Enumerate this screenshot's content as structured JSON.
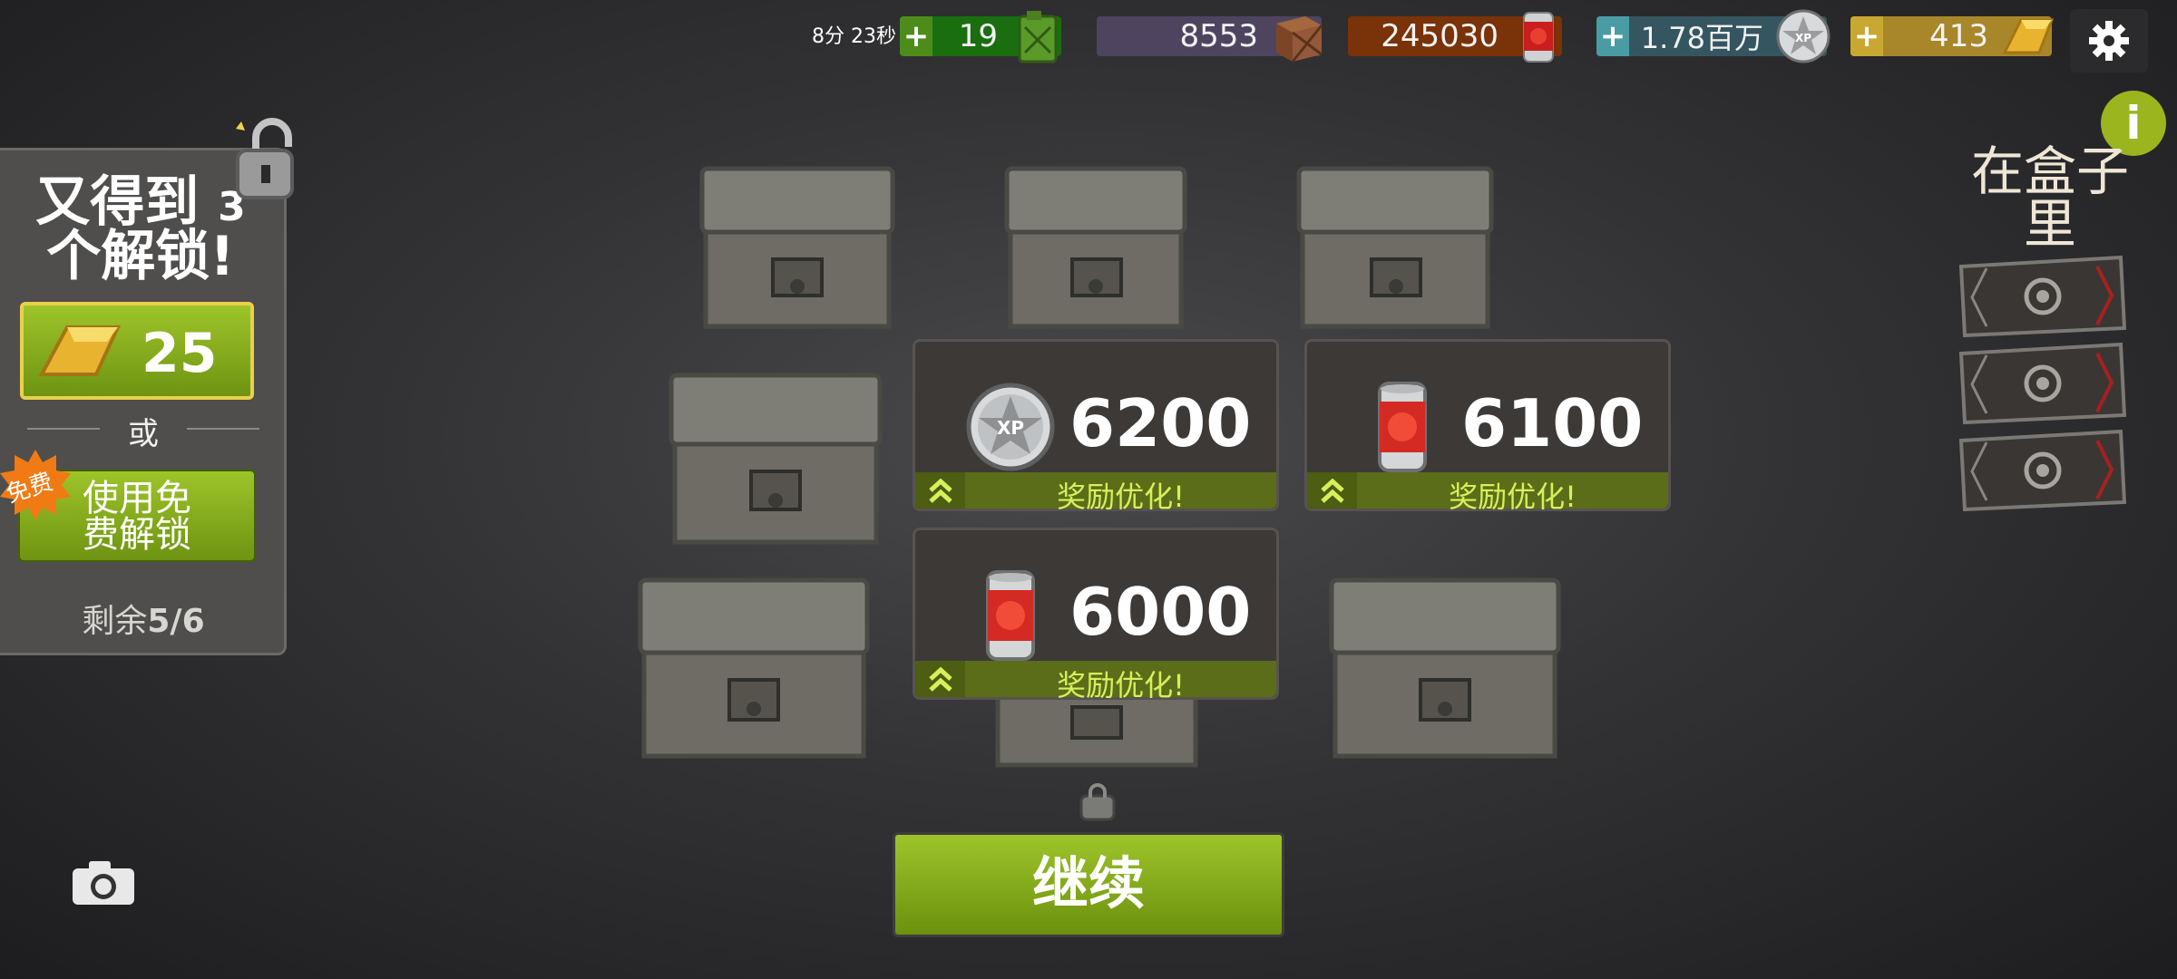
{
  "topbar": {
    "timer": "8分 23秒",
    "fuel": {
      "value": "19",
      "icon": "fuel-can-icon",
      "color": "#1d7a12"
    },
    "supplies": {
      "value": "8553",
      "icon": "wooden-crate-icon",
      "color": "#5c4c6e"
    },
    "food": {
      "value": "245030",
      "icon": "tomato-can-icon",
      "color": "#8a3a0c"
    },
    "xp": {
      "value": "1.78百万",
      "icon": "xp-badge-icon",
      "color": "#3c5c68"
    },
    "gold": {
      "value": "413",
      "icon": "gold-bar-icon",
      "color": "#b2922a"
    }
  },
  "left_panel": {
    "title_line1": "又得到",
    "title_count": "3",
    "title_line2": "个解锁!",
    "gold_cost": "25",
    "or_text": "或",
    "free_badge": "免费",
    "free_button_label_1": "使用免",
    "free_button_label_2": "费解锁",
    "remaining_label": "剩余",
    "remaining_value": "5/6"
  },
  "rewards": [
    {
      "amount": "6200",
      "icon": "xp-badge-icon",
      "label": "奖励优化!"
    },
    {
      "amount": "6100",
      "icon": "tomato-can-icon",
      "label": "奖励优化!"
    },
    {
      "amount": "6000",
      "icon": "tomato-can-icon",
      "label": "奖励优化!"
    }
  ],
  "continue_label": "继续",
  "right_panel": {
    "title": "在盒子里"
  }
}
